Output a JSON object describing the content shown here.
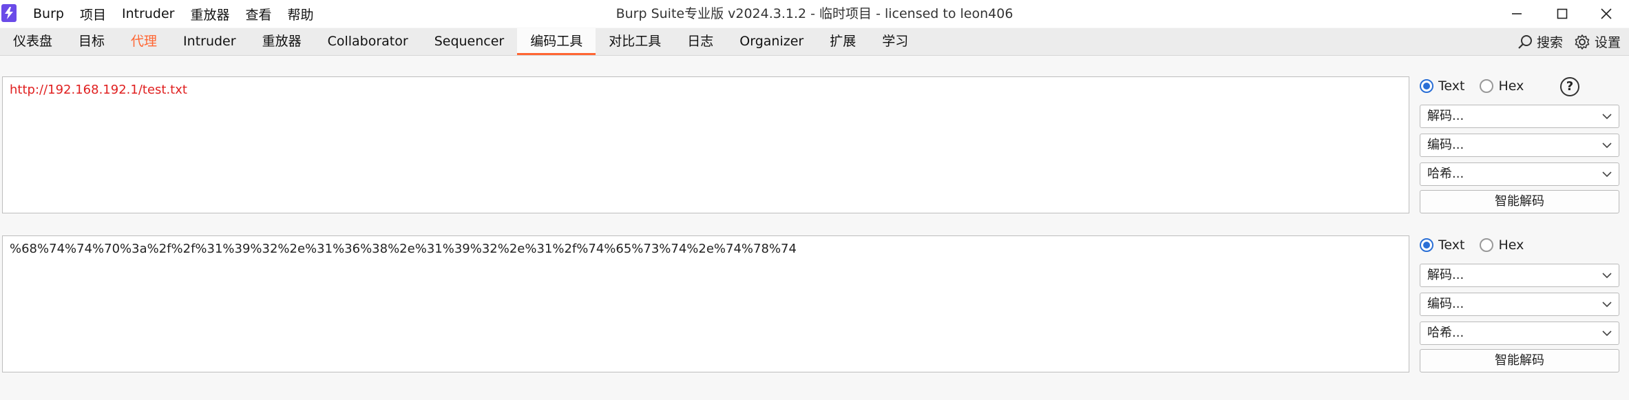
{
  "titlebar": {
    "menu": [
      "Burp",
      "项目",
      "Intruder",
      "重放器",
      "查看",
      "帮助"
    ],
    "title": "Burp Suite专业版  v2024.3.1.2 - 临时项目 - licensed to leon406"
  },
  "tabs": [
    "仪表盘",
    "目标",
    "代理",
    "Intruder",
    "重放器",
    "Collaborator",
    "Sequencer",
    "编码工具",
    "对比工具",
    "日志",
    "Organizer",
    "扩展",
    "学习"
  ],
  "active_tab": "编码工具",
  "highlight_tab": "代理",
  "toolbar_right": {
    "search_label": "搜索",
    "settings_label": "设置"
  },
  "panels": [
    {
      "content": "http://192.168.192.1/test.txt",
      "text_color": "#e02020",
      "mode_text": "Text",
      "mode_hex": "Hex",
      "selected_mode": "Text",
      "decode_as": "解码...",
      "encode_as": "编码...",
      "hash": "哈希...",
      "smart_decode": "智能解码",
      "help": "?"
    },
    {
      "content": "%68%74%74%70%3a%2f%2f%31%39%32%2e%31%36%38%2e%31%39%32%2e%31%2f%74%65%73%74%2e%74%78%74",
      "text_color": "#222222",
      "mode_text": "Text",
      "mode_hex": "Hex",
      "selected_mode": "Text",
      "decode_as": "解码...",
      "encode_as": "编码...",
      "hash": "哈希...",
      "smart_decode": "智能解码"
    }
  ],
  "colors": {
    "accent": "#ff6633",
    "logo": "#6a4be8",
    "radio": "#2a6fd6"
  }
}
